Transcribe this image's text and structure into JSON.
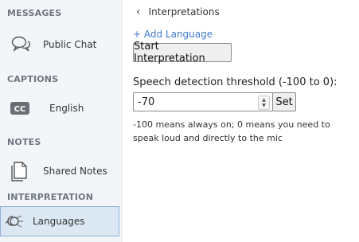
{
  "sidebar": {
    "sections": {
      "messages": "MESSAGES",
      "captions": "CAPTIONS",
      "notes": "NOTES",
      "interpretation": "INTERPRETATION"
    },
    "items": {
      "public_chat": "Public Chat",
      "english": "English",
      "shared_notes": "Shared Notes",
      "languages": "Languages"
    },
    "icons": {
      "public_chat": "chat-bubbles-icon",
      "english": "closed-captions-icon",
      "shared_notes": "notes-icon",
      "languages": "interpretation-icon"
    },
    "active_item": "languages"
  },
  "main": {
    "header_title": "Interpretations",
    "add_language": "+ Add Language",
    "start_button": "Start Interpretation",
    "threshold_label": "Speech detection threshold (-100 to 0):",
    "threshold_value": "-70",
    "set_button": "Set",
    "help_text": "-100 means always on; 0 means you need to speak loud and directly to the mic"
  },
  "colors": {
    "sidebar_bg": "#f3f6f9",
    "active_bg": "#dbe7f3",
    "link": "#3f7ad2"
  }
}
